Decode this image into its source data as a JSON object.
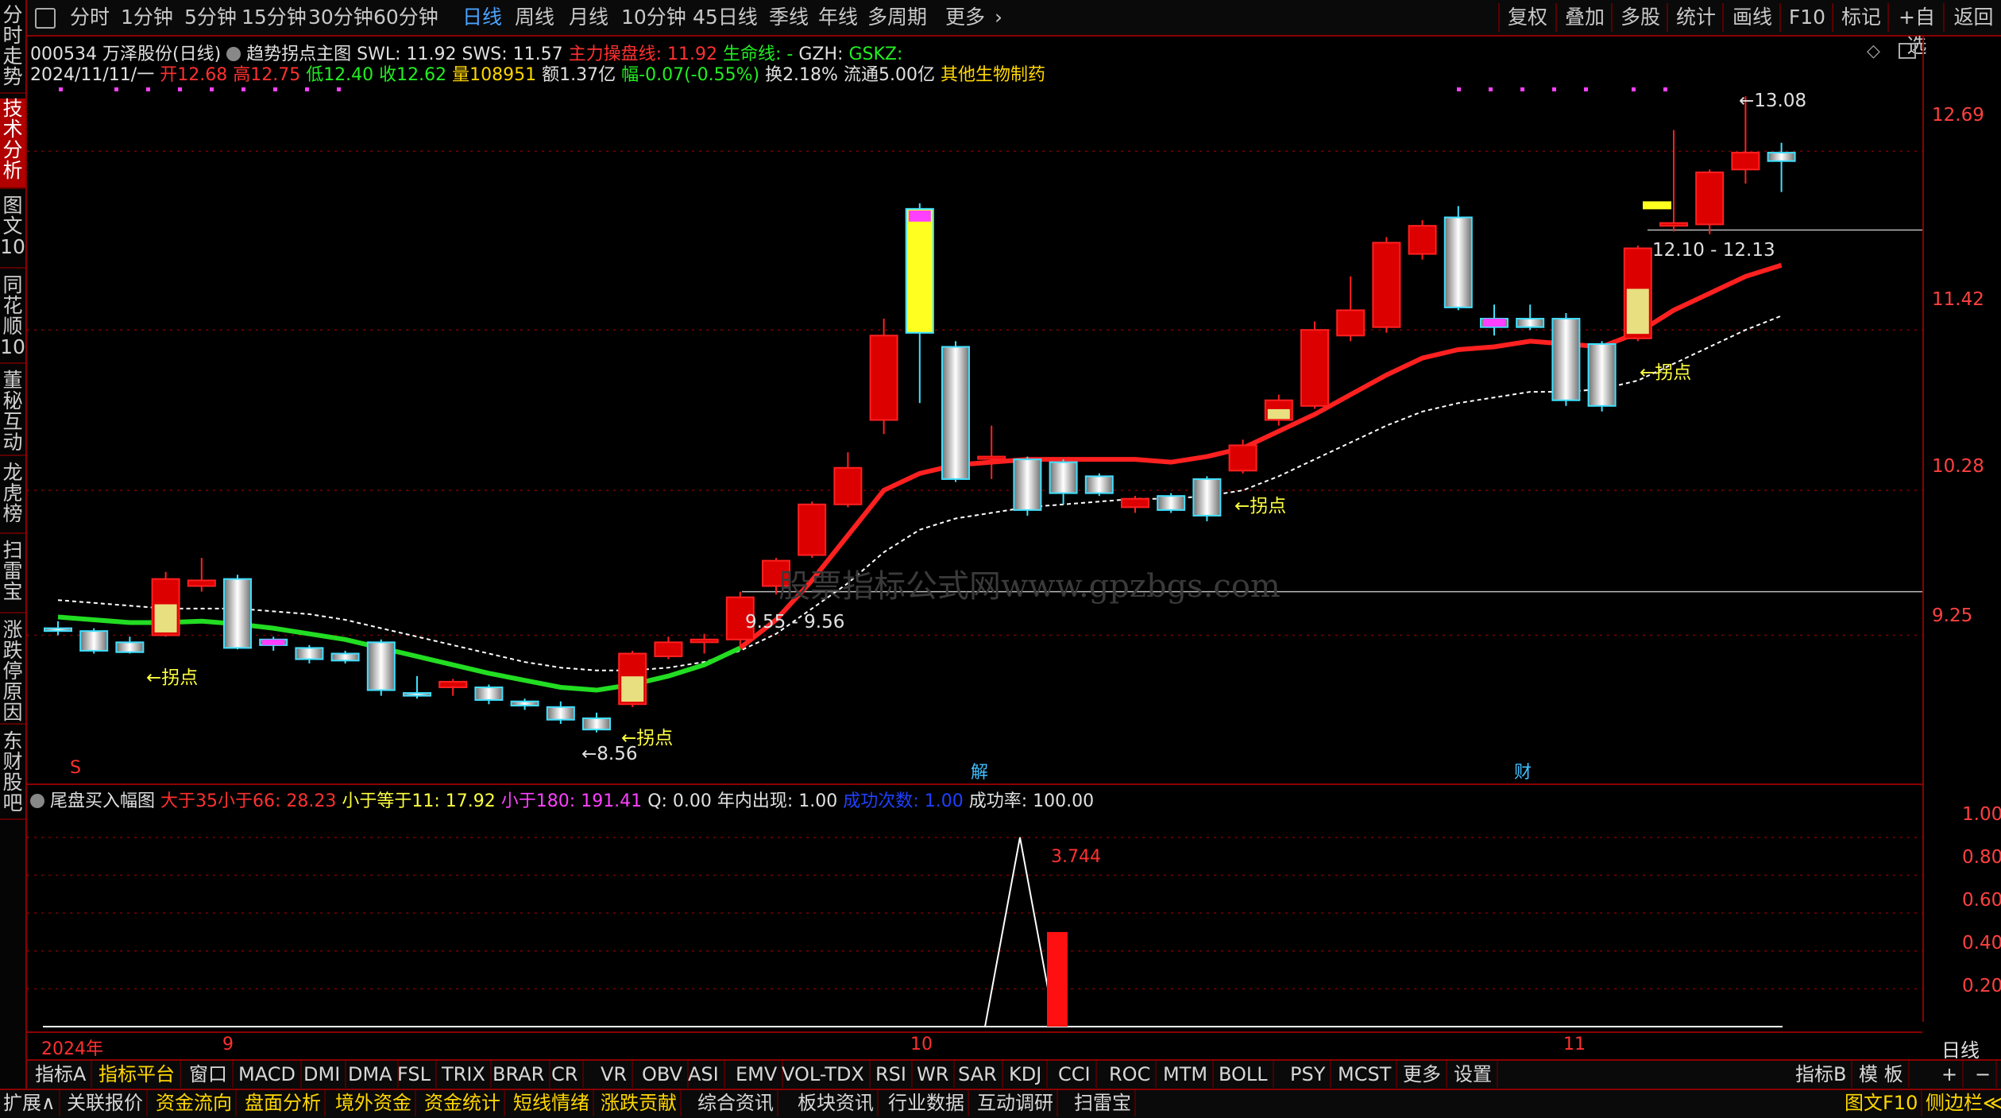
{
  "toolbar": {
    "periods": [
      "分时",
      "1分钟",
      "5分钟",
      "15分钟",
      "30分钟",
      "60分钟",
      "日线",
      "周线",
      "月线",
      "10分钟",
      "45日线",
      "季线",
      "年线",
      "多周期",
      "更多"
    ],
    "active_period": "日线",
    "right_buttons": [
      "复权",
      "叠加",
      "多股",
      "统计",
      "画线",
      "F10",
      "标记",
      "+自选",
      "返回"
    ]
  },
  "left_tabs": [
    "分时走势",
    "技术分析",
    "图文10",
    "同花顺10",
    "董秘互动",
    "龙虎榜",
    "扫雷宝",
    "涨跌停原因",
    "东财股吧"
  ],
  "left_tab_active": "技术分析",
  "header": {
    "code": "000534",
    "name": "万泽股份(日线)",
    "indicator": "趋势拐点主图",
    "swl": "SWL: 11.92",
    "sws": "SWS: 11.57",
    "zl": "主力操盘线: 11.92",
    "sml": "生命线: -",
    "gzh": "GZH:",
    "gskz": "GSKZ:",
    "date": "2024/11/11/一",
    "open": "开12.68",
    "high": "高12.75",
    "low": "低12.40",
    "close": "收12.62",
    "vol": "量108951",
    "amount": "额1.37亿",
    "change": "幅-0.07(-0.55%)",
    "turnover": "换2.18%",
    "float": "流通5.00亿",
    "sector": "其他生物制药"
  },
  "annotations": {
    "inflection": "←拐点",
    "low_mark": "←8.56",
    "high_mark": "←13.08",
    "range1": "9.55 - 9.56",
    "range2": "12.10 - 12.13",
    "marker_s": "S",
    "marker_jie": "解",
    "marker_cai": "财",
    "watermark": "股票指标公式网www.gpzbgs.com"
  },
  "price_axis": [
    "12.69",
    "11.42",
    "10.28",
    "9.25"
  ],
  "sub_header": {
    "name": "尾盘买入幅图",
    "a": "大于35小于66: 28.23",
    "b": "小于等于11: 17.92",
    "c": "小于180: 191.41",
    "q": "Q: 0.00",
    "year": "年内出现: 1.00",
    "succ": "成功次数: 1.00",
    "rate": "成功率: 100.00",
    "bar_label": "3.744"
  },
  "sub_axis": [
    "1.00",
    "0.80",
    "0.60",
    "0.40",
    "0.20"
  ],
  "date_axis": {
    "y2024": "2024年",
    "m9": "9",
    "m10": "10",
    "m11": "11",
    "period": "日线"
  },
  "indicator_tabs": [
    "指标A",
    "指标平台",
    "窗口",
    "MACD",
    "DMI",
    "DMA",
    "FSL",
    "TRIX",
    "BRAR",
    "CR",
    "VR",
    "OBV",
    "ASI",
    "EMV",
    "VOL-TDX",
    "RSI",
    "WR",
    "SAR",
    "KDJ",
    "CCI",
    "ROC",
    "MTM",
    "BOLL",
    "PSY",
    "MCST",
    "更多",
    "设置"
  ],
  "indicator_right": [
    "指标B",
    "模 板",
    "+",
    "−"
  ],
  "status_tabs": [
    "扩展∧",
    "关联报价",
    "资金流向",
    "盘面分析",
    "境外资金",
    "资金统计",
    "短线情绪",
    "涨跌贡献",
    "综合资讯",
    "板块资讯",
    "行业数据",
    "互动调研",
    "扫雷宝"
  ],
  "status_right": [
    "图文F10",
    "侧边栏≪"
  ],
  "colors": {
    "up": "#ff2020",
    "down": "#40e0ff",
    "green": "#22dd22",
    "yellow": "#ffff40",
    "magenta": "#ff40ff"
  },
  "chart_data": [
    {
      "type": "candlestick",
      "y_range": [
        8.4,
        13.2
      ],
      "candles": [
        {
          "o": 9.3,
          "h": 9.35,
          "l": 9.25,
          "c": 9.28
        },
        {
          "o": 9.28,
          "h": 9.3,
          "l": 9.12,
          "c": 9.14
        },
        {
          "o": 9.2,
          "h": 9.24,
          "l": 9.12,
          "c": 9.13
        },
        {
          "o": 9.25,
          "h": 9.7,
          "l": 9.24,
          "c": 9.65
        },
        {
          "o": 9.6,
          "h": 9.8,
          "l": 9.56,
          "c": 9.64
        },
        {
          "o": 9.65,
          "h": 9.68,
          "l": 9.15,
          "c": 9.16
        },
        {
          "o": 9.22,
          "h": 9.24,
          "l": 9.14,
          "c": 9.18
        },
        {
          "o": 9.16,
          "h": 9.18,
          "l": 9.05,
          "c": 9.08
        },
        {
          "o": 9.12,
          "h": 9.14,
          "l": 9.05,
          "c": 9.07
        },
        {
          "o": 9.2,
          "h": 9.22,
          "l": 8.82,
          "c": 8.86
        },
        {
          "o": 8.84,
          "h": 8.96,
          "l": 8.8,
          "c": 8.82
        },
        {
          "o": 8.88,
          "h": 8.94,
          "l": 8.82,
          "c": 8.92
        },
        {
          "o": 8.88,
          "h": 8.9,
          "l": 8.76,
          "c": 8.79
        },
        {
          "o": 8.78,
          "h": 8.8,
          "l": 8.72,
          "c": 8.75
        },
        {
          "o": 8.74,
          "h": 8.78,
          "l": 8.62,
          "c": 8.65
        },
        {
          "o": 8.66,
          "h": 8.7,
          "l": 8.56,
          "c": 8.58
        },
        {
          "o": 8.76,
          "h": 9.14,
          "l": 8.74,
          "c": 9.12
        },
        {
          "o": 9.1,
          "h": 9.24,
          "l": 9.08,
          "c": 9.2
        },
        {
          "o": 9.2,
          "h": 9.26,
          "l": 9.12,
          "c": 9.22
        },
        {
          "o": 9.22,
          "h": 9.56,
          "l": 9.18,
          "c": 9.52
        },
        {
          "o": 9.6,
          "h": 9.8,
          "l": 9.54,
          "c": 9.78
        },
        {
          "o": 9.82,
          "h": 10.2,
          "l": 9.8,
          "c": 10.18
        },
        {
          "o": 10.18,
          "h": 10.55,
          "l": 10.16,
          "c": 10.44
        },
        {
          "o": 10.78,
          "h": 11.5,
          "l": 10.68,
          "c": 11.38
        },
        {
          "o": 12.28,
          "h": 12.32,
          "l": 10.9,
          "c": 11.4
        },
        {
          "o": 11.3,
          "h": 11.34,
          "l": 10.34,
          "c": 10.36
        },
        {
          "o": 10.52,
          "h": 10.74,
          "l": 10.36,
          "c": 10.52
        },
        {
          "o": 10.5,
          "h": 10.52,
          "l": 10.1,
          "c": 10.14
        },
        {
          "o": 10.48,
          "h": 10.5,
          "l": 10.18,
          "c": 10.26
        },
        {
          "o": 10.38,
          "h": 10.4,
          "l": 10.24,
          "c": 10.26
        },
        {
          "o": 10.16,
          "h": 10.24,
          "l": 10.12,
          "c": 10.22
        },
        {
          "o": 10.24,
          "h": 10.26,
          "l": 10.12,
          "c": 10.14
        },
        {
          "o": 10.36,
          "h": 10.38,
          "l": 10.06,
          "c": 10.1
        },
        {
          "o": 10.42,
          "h": 10.64,
          "l": 10.4,
          "c": 10.6
        },
        {
          "o": 10.78,
          "h": 10.96,
          "l": 10.74,
          "c": 10.92
        },
        {
          "o": 10.88,
          "h": 11.48,
          "l": 10.86,
          "c": 11.42
        },
        {
          "o": 11.38,
          "h": 11.8,
          "l": 11.34,
          "c": 11.56
        },
        {
          "o": 11.44,
          "h": 12.08,
          "l": 11.4,
          "c": 12.04
        },
        {
          "o": 11.96,
          "h": 12.2,
          "l": 11.92,
          "c": 12.16
        },
        {
          "o": 12.22,
          "h": 12.3,
          "l": 11.56,
          "c": 11.58
        },
        {
          "o": 11.5,
          "h": 11.6,
          "l": 11.38,
          "c": 11.44
        },
        {
          "o": 11.5,
          "h": 11.6,
          "l": 11.42,
          "c": 11.44
        },
        {
          "o": 11.5,
          "h": 11.54,
          "l": 10.88,
          "c": 10.92
        },
        {
          "o": 11.32,
          "h": 11.34,
          "l": 10.84,
          "c": 10.88
        },
        {
          "o": 11.36,
          "h": 12.02,
          "l": 11.34,
          "c": 12.0
        },
        {
          "o": 12.16,
          "h": 12.84,
          "l": 12.12,
          "c": 12.18
        },
        {
          "o": 12.17,
          "h": 12.56,
          "l": 12.1,
          "c": 12.54
        },
        {
          "o": 12.56,
          "h": 13.08,
          "l": 12.46,
          "c": 12.68
        },
        {
          "o": 12.68,
          "h": 12.75,
          "l": 12.4,
          "c": 12.62
        }
      ],
      "support_line": [
        9.38,
        9.36,
        9.34,
        9.34,
        9.35,
        9.33,
        9.3,
        9.26,
        9.22,
        9.16,
        9.1,
        9.04,
        8.98,
        8.93,
        8.88,
        8.86,
        8.9,
        8.96,
        9.04,
        9.16,
        9.36,
        9.64,
        9.96,
        10.28,
        10.4,
        10.46,
        10.48,
        10.5,
        10.5,
        10.5,
        10.5,
        10.48,
        10.52,
        10.58,
        10.7,
        10.82,
        10.96,
        11.1,
        11.22,
        11.28,
        11.3,
        11.34,
        11.32,
        11.3,
        11.4,
        11.56,
        11.68,
        11.8,
        11.88
      ],
      "dashed_line": [
        9.5,
        9.48,
        9.46,
        9.44,
        9.44,
        9.44,
        9.42,
        9.4,
        9.36,
        9.3,
        9.24,
        9.18,
        9.12,
        9.06,
        9.02,
        9.0,
        9.0,
        9.02,
        9.06,
        9.14,
        9.26,
        9.44,
        9.62,
        9.84,
        10.0,
        10.08,
        10.12,
        10.16,
        10.18,
        10.2,
        10.22,
        10.22,
        10.24,
        10.28,
        10.38,
        10.5,
        10.62,
        10.74,
        10.84,
        10.9,
        10.94,
        10.98,
        10.98,
        11.0,
        11.06,
        11.18,
        11.3,
        11.42,
        11.52
      ]
    },
    {
      "type": "line",
      "y_range": [
        0,
        1.1
      ],
      "x": [
        0,
        1,
        2,
        3
      ],
      "values": [
        0,
        1.0,
        0,
        0
      ],
      "bar_value": 0.5
    }
  ]
}
